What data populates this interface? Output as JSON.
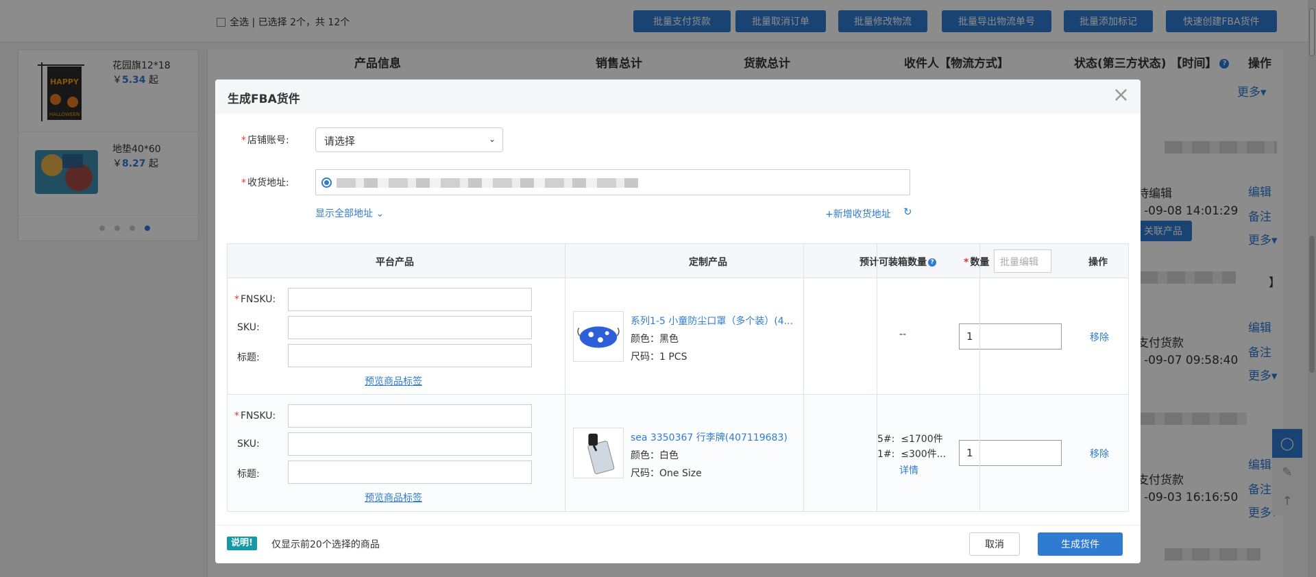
{
  "background": {
    "select_all": "全选 | 已选择 2个，共 12个",
    "toolbar": [
      "批量支付货款",
      "批量取消订单",
      "批量修改物流",
      "批量导出物流单号",
      "批量添加标记",
      "快速创建FBA货件"
    ],
    "left_products": [
      {
        "name": "花园旗12*18",
        "price_prefix": "￥",
        "price": "5.34",
        "price_suffix": " 起"
      },
      {
        "name": "地垫40*60",
        "price_prefix": "￥",
        "price": "8.27",
        "price_suffix": " 起"
      }
    ],
    "table_headers": [
      "产品信息",
      "销售总计",
      "货款总计",
      "收件人【物流方式】",
      "状态(第三方状态) 【时间】",
      "操作"
    ],
    "rows": [
      {
        "status": "待编辑",
        "time": "-09-08 14:01:29",
        "btn": "关联产品",
        "actions": [
          "编辑",
          "备注",
          "更多▾"
        ]
      },
      {
        "status": "支付货款",
        "time": "-09-07 09:58:40",
        "actions": [
          "编辑",
          "备注",
          "更多▾"
        ]
      },
      {
        "status": "支付货款",
        "time": "-09-03 16:16:50",
        "actions": [
          "编辑",
          "备注",
          "更多▾"
        ]
      }
    ],
    "top_more": "更多▾",
    "bracket": "】"
  },
  "modal": {
    "title": "生成FBA货件",
    "close": "×",
    "store_label": "店铺账号:",
    "store_placeholder": "请选择",
    "address_label": "收货地址:",
    "show_all_addresses": "显示全部地址",
    "add_address": "新增收货地址",
    "columns": {
      "platform": "平台产品",
      "custom": "定制产品",
      "estimate": "预计可装箱数量",
      "qty": "数量",
      "batch_placeholder": "批量编辑",
      "ops": "操作"
    },
    "labels": {
      "fnsku": "FNSKU:",
      "sku": "SKU:",
      "title": "标题:",
      "preview": "预览商品标签"
    },
    "items": [
      {
        "name": "系列1-5 小童防尘口罩（多个装）(4...",
        "color": "颜色：黑色",
        "size": "尺码：1 PCS",
        "estimate_1": "--",
        "qty": "1",
        "remove": "移除"
      },
      {
        "name": "sea 3350367 行李牌(407119683)",
        "color": "颜色：白色",
        "size": "尺码：One Size",
        "estimate_1": "5#:  ≤1700件",
        "estimate_2": "1#:  ≤300件...",
        "detail": "详情",
        "qty": "1",
        "remove": "移除"
      }
    ],
    "footer": {
      "badge": "说明!",
      "note": "仅显示前20个选择的商品",
      "cancel": "取消",
      "submit": "生成货件"
    }
  }
}
